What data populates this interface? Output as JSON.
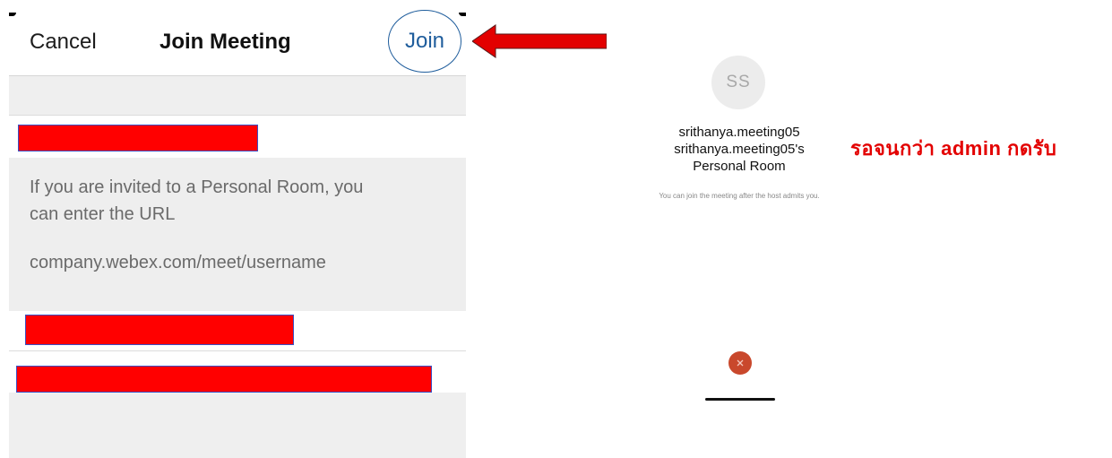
{
  "join_meeting": {
    "cancel_label": "Cancel",
    "title": "Join Meeting",
    "join_label": "Join",
    "hint_text": "If you are invited to a Personal Room, you\ncan enter the URL",
    "hint_url": "company.webex.com/meet/username"
  },
  "waiting_room": {
    "avatar_initials": "SS",
    "name_line1": "srithanya.meeting05",
    "name_line2": "srithanya.meeting05's",
    "name_line3": "Personal Room",
    "wait_message": "You can join the meeting after the host admits you."
  },
  "annotation": {
    "note": "รอจนกว่า admin กดรับ",
    "note_color": "#e30000",
    "arrow_color": "#e30000"
  },
  "colors": {
    "accent": "#1f5d9c",
    "redaction": "#ff0000",
    "leave_button": "#c9482c"
  },
  "icons": {
    "leave": "close-icon",
    "pointer": "left-arrow-icon"
  }
}
